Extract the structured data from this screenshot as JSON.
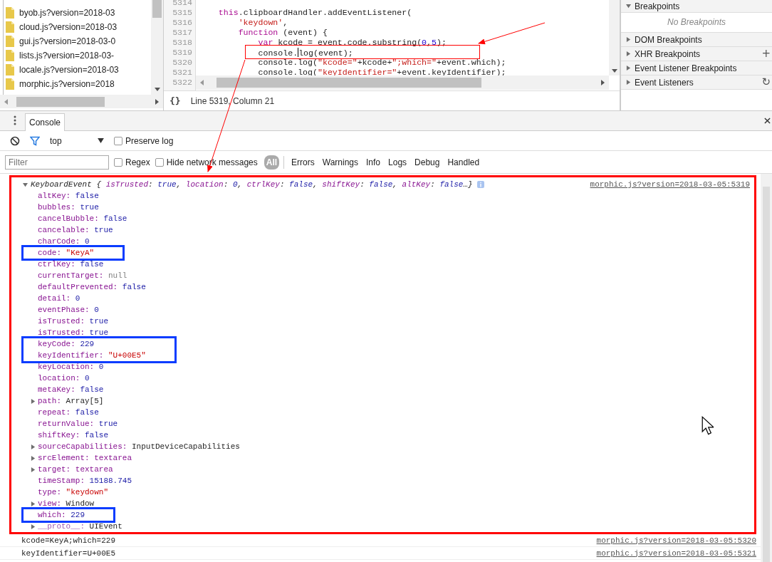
{
  "sources": {
    "files": [
      {
        "name": "byob.js?version=2018-03"
      },
      {
        "name": "cloud.js?version=2018-03"
      },
      {
        "name": "gui.js?version=2018-03-0"
      },
      {
        "name": "lists.js?version=2018-03-"
      },
      {
        "name": "locale.js?version=2018-03"
      },
      {
        "name": "morphic.js?version=2018"
      }
    ]
  },
  "editor": {
    "lines": [
      {
        "number": "5314"
      },
      {
        "number": "5315",
        "tokens": [
          {
            "kind": "keyword",
            "text": "    this"
          },
          {
            "kind": "plain",
            "text": ".clipboardHandler.addEventListener("
          }
        ]
      },
      {
        "number": "5316",
        "tokens": [
          {
            "kind": "string",
            "text": "        'keydown'"
          },
          {
            "kind": "plain",
            "text": ","
          }
        ]
      },
      {
        "number": "5317",
        "tokens": [
          {
            "kind": "keyword",
            "text": "        function"
          },
          {
            "kind": "plain",
            "text": " (event) {"
          }
        ]
      },
      {
        "number": "5318",
        "tokens": [
          {
            "kind": "keyword",
            "text": "            var"
          },
          {
            "kind": "plain",
            "text": " kcode = event.code.substring("
          },
          {
            "kind": "number",
            "text": "0"
          },
          {
            "kind": "plain",
            "text": ","
          },
          {
            "kind": "number",
            "text": "5"
          },
          {
            "kind": "plain",
            "text": ");"
          }
        ]
      },
      {
        "number": "5319",
        "tokens": [
          {
            "kind": "plain",
            "text": "            console."
          },
          {
            "kind": "caret"
          },
          {
            "kind": "plain",
            "text": "log(event);"
          }
        ]
      },
      {
        "number": "5320",
        "tokens": [
          {
            "kind": "plain",
            "text": "            console.log("
          },
          {
            "kind": "string",
            "text": "\"kcode=\""
          },
          {
            "kind": "plain",
            "text": "+kcode+"
          },
          {
            "kind": "string",
            "text": "\";which=\""
          },
          {
            "kind": "plain",
            "text": "+event.which);"
          }
        ]
      },
      {
        "number": "5321",
        "tokens": [
          {
            "kind": "plain",
            "text": "            console.log("
          },
          {
            "kind": "string",
            "text": "\"keyIdentifier=\""
          },
          {
            "kind": "plain",
            "text": "+event.keyIdentifier);"
          }
        ]
      },
      {
        "number": "5322"
      }
    ],
    "pretty_print": "{}",
    "status": "Line 5319, Column 21"
  },
  "debugger_sidebar": {
    "sections": [
      {
        "title": "Breakpoints",
        "expanded": true,
        "empty_message": "No Breakpoints"
      },
      {
        "title": "DOM Breakpoints",
        "expanded": false
      },
      {
        "title": "XHR Breakpoints",
        "expanded": false,
        "action": "+"
      },
      {
        "title": "Event Listener Breakpoints",
        "expanded": false
      },
      {
        "title": "Event Listeners",
        "expanded": false,
        "action": "↻"
      }
    ]
  },
  "drawer": {
    "tabs": [
      {
        "label": "Console",
        "selected": true
      }
    ],
    "context": "top",
    "preserve_log": {
      "label": "Preserve log",
      "checked": false
    },
    "filter": {
      "placeholder": "Filter"
    },
    "regex": {
      "label": "Regex",
      "checked": false
    },
    "hide_network": {
      "label": "Hide network messages",
      "checked": false
    },
    "levels": [
      {
        "label": "All",
        "selected": true
      },
      {
        "label": "Errors",
        "selected": false
      },
      {
        "label": "Warnings",
        "selected": false
      },
      {
        "label": "Info",
        "selected": false
      },
      {
        "label": "Logs",
        "selected": false
      },
      {
        "label": "Debug",
        "selected": false
      },
      {
        "label": "Handled",
        "selected": false
      }
    ]
  },
  "console": {
    "messages": [
      {
        "kind": "object",
        "outlined": true,
        "expanded": true,
        "class_name": "KeyboardEvent",
        "source": "morphic.js?version=2018-03-05:5319",
        "preview": [
          {
            "kind": "punct",
            "text": "{"
          },
          {
            "kind": "key",
            "text": "isTrusted"
          },
          {
            "kind": "punct",
            "text": ":"
          },
          {
            "kind": "value",
            "text": "true"
          },
          {
            "kind": "punct",
            "text": ","
          },
          {
            "kind": "key",
            "text": "location"
          },
          {
            "kind": "punct",
            "text": ":"
          },
          {
            "kind": "value",
            "text": "0"
          },
          {
            "kind": "punct",
            "text": ","
          },
          {
            "kind": "key",
            "text": "ctrlKey"
          },
          {
            "kind": "punct",
            "text": ":"
          },
          {
            "kind": "value",
            "text": "false"
          },
          {
            "kind": "punct",
            "text": ","
          },
          {
            "kind": "key",
            "text": "shiftKey"
          },
          {
            "kind": "punct",
            "text": ":"
          },
          {
            "kind": "value",
            "text": "false"
          },
          {
            "kind": "punct",
            "text": ","
          },
          {
            "kind": "key",
            "text": "altKey"
          },
          {
            "kind": "punct",
            "text": ":"
          },
          {
            "kind": "value",
            "text": "false"
          },
          {
            "kind": "punct",
            "text": "…}"
          }
        ],
        "properties": [
          {
            "name": "altKey:",
            "value": "false",
            "kind": "boolean",
            "expandable": false,
            "boxed": false
          },
          {
            "name": "bubbles:",
            "value": "true",
            "kind": "boolean",
            "expandable": false,
            "boxed": false
          },
          {
            "name": "cancelBubble:",
            "value": "false",
            "kind": "boolean",
            "expandable": false,
            "boxed": false
          },
          {
            "name": "cancelable:",
            "value": "true",
            "kind": "boolean",
            "expandable": false,
            "boxed": false
          },
          {
            "name": "charCode:",
            "value": "0",
            "kind": "number",
            "expandable": false,
            "boxed": false
          },
          {
            "name": "code:",
            "value": "\"KeyA\"",
            "kind": "string",
            "expandable": false,
            "boxed": true
          },
          {
            "name": "ctrlKey:",
            "value": "false",
            "kind": "boolean",
            "expandable": false,
            "boxed": false
          },
          {
            "name": "currentTarget:",
            "value": "null",
            "kind": "null",
            "expandable": false,
            "boxed": false
          },
          {
            "name": "defaultPrevented:",
            "value": "false",
            "kind": "boolean",
            "expandable": false,
            "boxed": false
          },
          {
            "name": "detail:",
            "value": "0",
            "kind": "number",
            "expandable": false,
            "boxed": false
          },
          {
            "name": "eventPhase:",
            "value": "0",
            "kind": "number",
            "expandable": false,
            "boxed": false
          },
          {
            "name": "isTrusted:",
            "value": "true",
            "kind": "boolean",
            "expandable": false,
            "boxed": false
          },
          {
            "name": "isTrusted:",
            "value": "true",
            "kind": "boolean",
            "expandable": false,
            "boxed": false
          },
          {
            "name": "keyCode:",
            "value": "229",
            "kind": "number",
            "expandable": false,
            "boxed": true
          },
          {
            "name": "keyIdentifier:",
            "value": "\"U+00E5\"",
            "kind": "string",
            "expandable": false,
            "boxed": true
          },
          {
            "name": "keyLocation:",
            "value": "0",
            "kind": "number",
            "expandable": false,
            "boxed": false
          },
          {
            "name": "location:",
            "value": "0",
            "kind": "number",
            "expandable": false,
            "boxed": false
          },
          {
            "name": "metaKey:",
            "value": "false",
            "kind": "boolean",
            "expandable": false,
            "boxed": false
          },
          {
            "name": "path:",
            "value": "Array[5]",
            "kind": "object",
            "expandable": true,
            "boxed": false
          },
          {
            "name": "repeat:",
            "value": "false",
            "kind": "boolean",
            "expandable": false,
            "boxed": false
          },
          {
            "name": "returnValue:",
            "value": "true",
            "kind": "boolean",
            "expandable": false,
            "boxed": false
          },
          {
            "name": "shiftKey:",
            "value": "false",
            "kind": "boolean",
            "expandable": false,
            "boxed": false
          },
          {
            "name": "sourceCapabilities:",
            "value": "InputDeviceCapabilities",
            "kind": "object",
            "expandable": true,
            "boxed": false
          },
          {
            "name": "srcElement:",
            "value": "textarea",
            "kind": "node",
            "expandable": true,
            "boxed": false
          },
          {
            "name": "target:",
            "value": "textarea",
            "kind": "node",
            "expandable": true,
            "boxed": false
          },
          {
            "name": "timeStamp:",
            "value": "15188.745",
            "kind": "number",
            "expandable": false,
            "boxed": false
          },
          {
            "name": "type:",
            "value": "\"keydown\"",
            "kind": "string",
            "expandable": false,
            "boxed": false
          },
          {
            "name": "view:",
            "value": "Window",
            "kind": "object",
            "expandable": true,
            "boxed": false
          },
          {
            "name": "which:",
            "value": "229",
            "kind": "number",
            "expandable": false,
            "boxed": true
          },
          {
            "name": "__proto__:",
            "value": "UIEvent",
            "kind": "object",
            "expandable": true,
            "boxed": false,
            "internal": true
          }
        ]
      },
      {
        "kind": "text",
        "text": "kcode=KeyA;which=229",
        "source": "morphic.js?version=2018-03-05:5320"
      },
      {
        "kind": "text",
        "text": "keyIdentifier=U+00E5",
        "source": "morphic.js?version=2018-03-05:5321"
      }
    ]
  }
}
